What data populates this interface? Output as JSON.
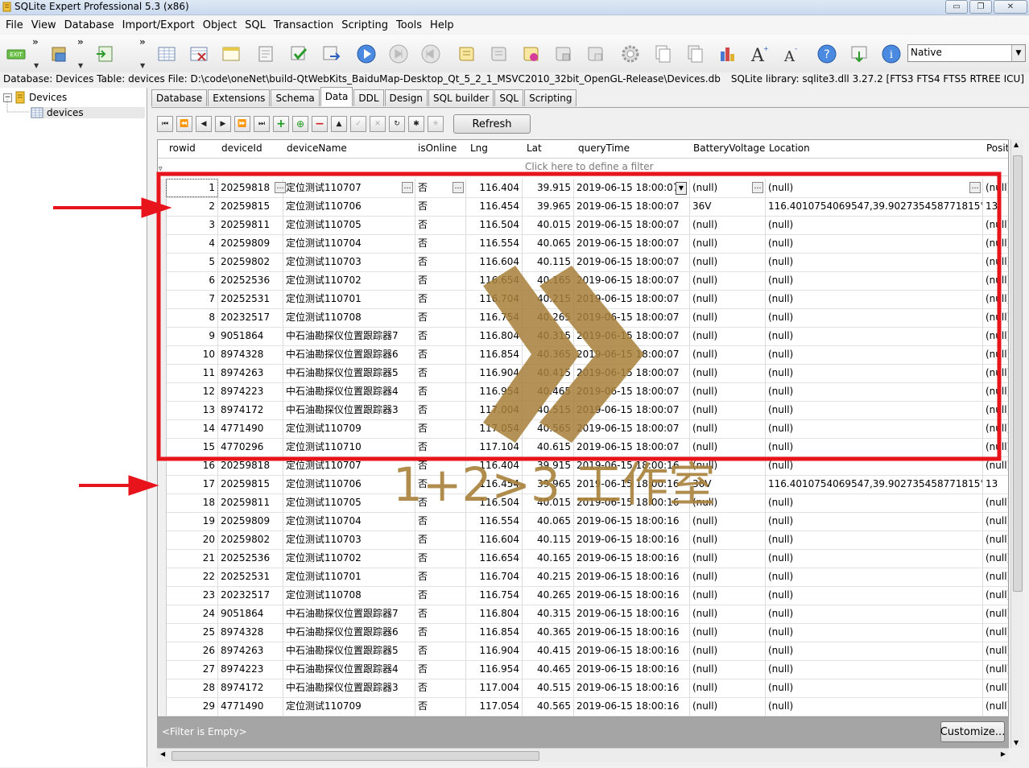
{
  "window": {
    "title": "SQLite Expert Professional 5.3 (x86)",
    "controls": [
      "minimize-icon",
      "maximize-icon",
      "close-icon"
    ]
  },
  "menu": [
    "File",
    "View",
    "Database",
    "Import/Export",
    "Object",
    "SQL",
    "Transaction",
    "Scripting",
    "Tools",
    "Help"
  ],
  "toolbar": {
    "buttons": [
      "exit-icon",
      "save-db-icon",
      "import-icon",
      "new-table-icon",
      "drop-table-icon",
      "new-view-icon",
      "edit-icon",
      "check-icon",
      "export-icon",
      "run-icon",
      "stop-icon",
      "back-icon",
      "script-icon",
      "sql-icon",
      "sql-run-icon",
      "attach-icon",
      "detach-icon",
      "settings-icon",
      "copy-icon",
      "paste-icon",
      "chart-icon",
      "font-increase-icon",
      "font-decrease-icon",
      "help-icon",
      "download-icon",
      "info-icon"
    ],
    "encoding": "Native"
  },
  "status": {
    "left": "Database: Devices   Table: devices   File: D:\\code\\oneNet\\build-QtWebKits_BaiduMap-Desktop_Qt_5_2_1_MSVC2010_32bit_OpenGL-Release\\Devices.db",
    "right": "SQLite library: sqlite3.dll 3.27.2 [FTS3 FTS4 FTS5 RTREE ICU]"
  },
  "tree": {
    "root": "Devices",
    "child": "devices"
  },
  "tabs": [
    "Database",
    "Extensions",
    "Schema",
    "Data",
    "DDL",
    "Design",
    "SQL builder",
    "SQL",
    "Scripting"
  ],
  "active_tab": "Data",
  "nav_buttons": [
    "first-page-icon",
    "prev-page-icon",
    "prev-icon",
    "next-icon",
    "next-page-icon",
    "last-icon",
    "add-icon",
    "insert-icon",
    "delete-icon",
    "up-icon",
    "post-icon",
    "cancel-icon",
    "refresh-small-icon",
    "asterisk-icon",
    "star-icon"
  ],
  "refresh_label": "Refresh",
  "grid": {
    "columns": [
      "rowid",
      "deviceId",
      "deviceName",
      "isOnline",
      "Lng",
      "Lat",
      "queryTime",
      "BatteryVoltage",
      "Location",
      "Posit"
    ],
    "filter_hint": "Click here to define a filter",
    "rows": [
      [
        "1",
        "20259818",
        "定位测试110707",
        "否",
        "116.404",
        "39.915",
        "2019-06-15 18:00:07",
        "(null)",
        "(null)",
        "(null)"
      ],
      [
        "2",
        "20259815",
        "定位测试110706",
        "否",
        "116.454",
        "39.965",
        "2019-06-15 18:00:07",
        "36V",
        "116.4010754069547,39.902735458771815°",
        "13"
      ],
      [
        "3",
        "20259811",
        "定位测试110705",
        "否",
        "116.504",
        "40.015",
        "2019-06-15 18:00:07",
        "(null)",
        "(null)",
        "(null)"
      ],
      [
        "4",
        "20259809",
        "定位测试110704",
        "否",
        "116.554",
        "40.065",
        "2019-06-15 18:00:07",
        "(null)",
        "(null)",
        "(null)"
      ],
      [
        "5",
        "20259802",
        "定位测试110703",
        "否",
        "116.604",
        "40.115",
        "2019-06-15 18:00:07",
        "(null)",
        "(null)",
        "(null)"
      ],
      [
        "6",
        "20252536",
        "定位测试110702",
        "否",
        "116.654",
        "40.165",
        "2019-06-15 18:00:07",
        "(null)",
        "(null)",
        "(null)"
      ],
      [
        "7",
        "20252531",
        "定位测试110701",
        "否",
        "116.704",
        "40.215",
        "2019-06-15 18:00:07",
        "(null)",
        "(null)",
        "(null)"
      ],
      [
        "8",
        "20232517",
        "定位测试110708",
        "否",
        "116.754",
        "40.265",
        "2019-06-15 18:00:07",
        "(null)",
        "(null)",
        "(null)"
      ],
      [
        "9",
        "9051864",
        "中石油勘探仪位置跟踪器7",
        "否",
        "116.804",
        "40.315",
        "2019-06-15 18:00:07",
        "(null)",
        "(null)",
        "(null)"
      ],
      [
        "10",
        "8974328",
        "中石油勘探仪位置跟踪器6",
        "否",
        "116.854",
        "40.365",
        "2019-06-15 18:00:07",
        "(null)",
        "(null)",
        "(null)"
      ],
      [
        "11",
        "8974263",
        "中石油勘探仪位置跟踪器5",
        "否",
        "116.904",
        "40.415",
        "2019-06-15 18:00:07",
        "(null)",
        "(null)",
        "(null)"
      ],
      [
        "12",
        "8974223",
        "中石油勘探仪位置跟踪器4",
        "否",
        "116.954",
        "40.465",
        "2019-06-15 18:00:07",
        "(null)",
        "(null)",
        "(null)"
      ],
      [
        "13",
        "8974172",
        "中石油勘探仪位置跟踪器3",
        "否",
        "117.004",
        "40.515",
        "2019-06-15 18:00:07",
        "(null)",
        "(null)",
        "(null)"
      ],
      [
        "14",
        "4771490",
        "定位测试110709",
        "否",
        "117.054",
        "40.565",
        "2019-06-15 18:00:07",
        "(null)",
        "(null)",
        "(null)"
      ],
      [
        "15",
        "4770296",
        "定位测试110710",
        "否",
        "117.104",
        "40.615",
        "2019-06-15 18:00:07",
        "(null)",
        "(null)",
        "(null)"
      ],
      [
        "16",
        "20259818",
        "定位测试110707",
        "否",
        "116.404",
        "39.915",
        "2019-06-15 18:00:16",
        "(null)",
        "(null)",
        "(null)"
      ],
      [
        "17",
        "20259815",
        "定位测试110706",
        "否",
        "116.454",
        "39.965",
        "2019-06-15 18:00:16",
        "36V",
        "116.4010754069547,39.902735458771815°",
        "13"
      ],
      [
        "18",
        "20259811",
        "定位测试110705",
        "否",
        "116.504",
        "40.015",
        "2019-06-15 18:00:16",
        "(null)",
        "(null)",
        "(null)"
      ],
      [
        "19",
        "20259809",
        "定位测试110704",
        "否",
        "116.554",
        "40.065",
        "2019-06-15 18:00:16",
        "(null)",
        "(null)",
        "(null)"
      ],
      [
        "20",
        "20259802",
        "定位测试110703",
        "否",
        "116.604",
        "40.115",
        "2019-06-15 18:00:16",
        "(null)",
        "(null)",
        "(null)"
      ],
      [
        "21",
        "20252536",
        "定位测试110702",
        "否",
        "116.654",
        "40.165",
        "2019-06-15 18:00:16",
        "(null)",
        "(null)",
        "(null)"
      ],
      [
        "22",
        "20252531",
        "定位测试110701",
        "否",
        "116.704",
        "40.215",
        "2019-06-15 18:00:16",
        "(null)",
        "(null)",
        "(null)"
      ],
      [
        "23",
        "20232517",
        "定位测试110708",
        "否",
        "116.754",
        "40.265",
        "2019-06-15 18:00:16",
        "(null)",
        "(null)",
        "(null)"
      ],
      [
        "24",
        "9051864",
        "中石油勘探仪位置跟踪器7",
        "否",
        "116.804",
        "40.315",
        "2019-06-15 18:00:16",
        "(null)",
        "(null)",
        "(null)"
      ],
      [
        "25",
        "8974328",
        "中石油勘探仪位置跟踪器6",
        "否",
        "116.854",
        "40.365",
        "2019-06-15 18:00:16",
        "(null)",
        "(null)",
        "(null)"
      ],
      [
        "26",
        "8974263",
        "中石油勘探仪位置跟踪器5",
        "否",
        "116.904",
        "40.415",
        "2019-06-15 18:00:16",
        "(null)",
        "(null)",
        "(null)"
      ],
      [
        "27",
        "8974223",
        "中石油勘探仪位置跟踪器4",
        "否",
        "116.954",
        "40.465",
        "2019-06-15 18:00:16",
        "(null)",
        "(null)",
        "(null)"
      ],
      [
        "28",
        "8974172",
        "中石油勘探仪位置跟踪器3",
        "否",
        "117.004",
        "40.515",
        "2019-06-15 18:00:16",
        "(null)",
        "(null)",
        "(null)"
      ],
      [
        "29",
        "4771490",
        "定位测试110709",
        "否",
        "117.054",
        "40.565",
        "2019-06-15 18:00:16",
        "(null)",
        "(null)",
        "(null)"
      ]
    ]
  },
  "footer": {
    "filter_text": "<Filter is Empty>",
    "customize_label": "Customize..."
  },
  "annotation": {
    "watermark_text": "1+2>3 工作室",
    "box_color": "#e8141b",
    "arrow_color": "#e8141b",
    "watermark_color": "#a8803a"
  }
}
